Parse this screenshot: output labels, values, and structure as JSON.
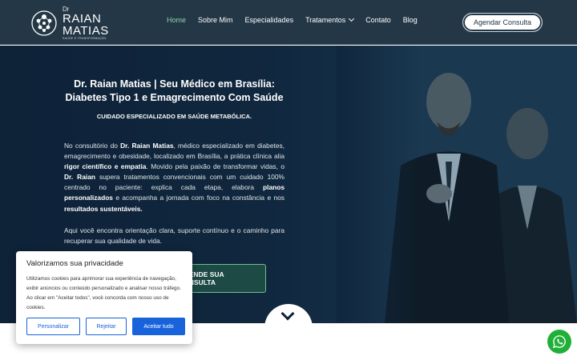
{
  "header": {
    "logo": {
      "prefix": "Dr",
      "name_line1": "RAIAN",
      "name_line2": "MATIAS",
      "tagline": "SAÚDE E TRANSFORMAÇÃO"
    },
    "nav": [
      {
        "label": "Home",
        "active": true
      },
      {
        "label": "Sobre Mim",
        "active": false
      },
      {
        "label": "Especialidades",
        "active": false
      },
      {
        "label": "Tratamentos",
        "active": false,
        "has_dropdown": true
      },
      {
        "label": "Contato",
        "active": false
      },
      {
        "label": "Blog",
        "active": false
      }
    ],
    "cta_label": "Agendar Consulta"
  },
  "hero": {
    "title_line1": "Dr. Raian Matias | Seu Médico em Brasília:",
    "title_line2": "Diabetes Tipo 1 e Emagrecimento Com Saúde",
    "subtitle": "CUIDADO ESPECIALIZADO EM SAÚDE METABÓLICA.",
    "p1": {
      "t1": "No consultório do ",
      "b1": "Dr. Raian Matias",
      "t2": ", médico especializado em diabetes, emagrecimento e obesidade, localizado em Brasília, a prática clínica alia ",
      "b2": "rigor científico e empatia",
      "t3": ". Movido pela paixão de transformar vidas, o ",
      "b3": "Dr. Raian",
      "t4": " supera tratamentos convencionais com um cuidado 100% centrado no paciente: explica cada etapa, elabora ",
      "b4": "planos personalizados",
      "t5": " e acompanha a jornada com foco na constância e nos ",
      "b5": "resultados sustentáveis."
    },
    "p2": "Aqui você encontra orientação clara, suporte contínuo e o caminho para recuperar sua qualidade de vida.",
    "schedule_label": "AGENDE SUA CONSULTA"
  },
  "cookie": {
    "title": "Valorizamos sua privacidade",
    "text": "Utilizamos cookies para aprimorar sua experiência de navegação, exibir anúncios ou conteúdo personalizado e analisar nosso tráfego. Ao clicar em \"Aceitar todos\", você concorda com nosso uso de cookies.",
    "customize_label": "Personalizar",
    "reject_label": "Rejeitar",
    "accept_label": "Aceitar tudo"
  },
  "colors": {
    "header_bg": "#243746",
    "hero_bg": "#0e2238",
    "accent_green": "#8fd3a9",
    "cookie_blue": "#1863dc",
    "whatsapp_green": "#20b038"
  },
  "icons": [
    "logo-mark-icon",
    "chevron-down-icon",
    "scroll-down-icon",
    "whatsapp-icon"
  ]
}
